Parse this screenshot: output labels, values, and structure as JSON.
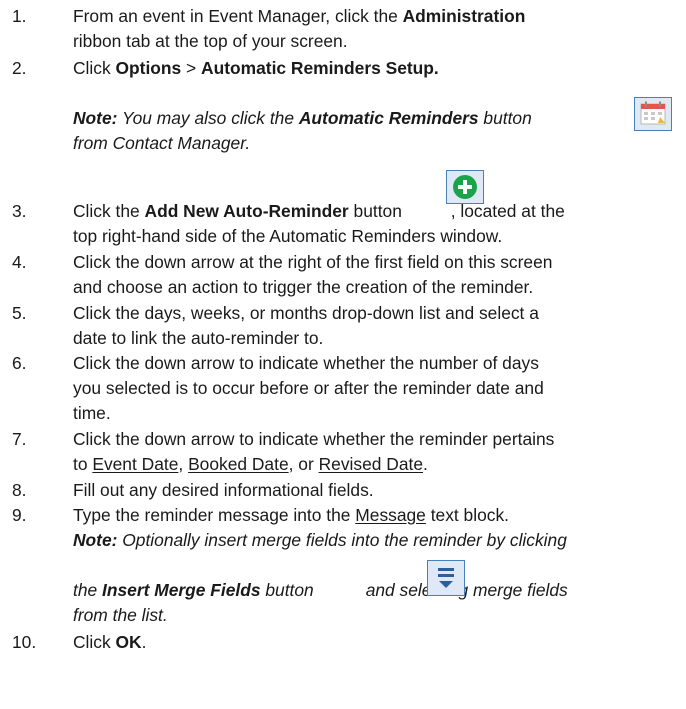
{
  "steps": [
    {
      "num": "1.",
      "line1": {
        "pre": "From an event in Event Manager, click the ",
        "bold": "Administration"
      },
      "line2": "ribbon tab at the top of your screen."
    },
    {
      "num": "2.",
      "pre": "Click ",
      "bold1": "Options",
      "mid": " > ",
      "bold2": "Automatic Reminders Setup."
    },
    {
      "note_label": "Note:",
      "pre": " You may also click the ",
      "bold": "Automatic Reminders",
      "post": " button",
      "line2": "from Contact Manager.",
      "icon": "calendar-reminder-icon"
    },
    {
      "num": "3.",
      "pre": "Click the ",
      "bold": "Add New Auto-Reminder",
      "post1": " button ",
      "post2": ", located at the",
      "line2": "top right-hand side of the Automatic Reminders window.",
      "icon": "add-plus-icon"
    },
    {
      "num": "4.",
      "line1": "Click the down arrow at the right of the first field on this screen",
      "line2": "and choose an action to trigger the creation of the reminder."
    },
    {
      "num": "5.",
      "line1": "Click the days, weeks, or months drop-down list and select a",
      "line2": "date to link the auto-reminder to."
    },
    {
      "num": "6.",
      "line1": "Click the down arrow to indicate whether the number of days",
      "line2": "you selected is to occur before or after the reminder date and",
      "line3": "time."
    },
    {
      "num": "7.",
      "line1": "Click the down arrow to indicate whether the reminder pertains",
      "pre": "to ",
      "u1": "Event Date",
      "sep1": ", ",
      "u2": "Booked Date",
      "sep2": ", or ",
      "u3": "Revised Date",
      "end": "."
    },
    {
      "num": "8.",
      "line1": "Fill out any desired informational fields."
    },
    {
      "num": "9.",
      "pre": "Type the reminder message into the ",
      "u": "Message",
      "post": " text block.",
      "note_label": "Note:",
      "note_text": " Optionally insert merge fields into the reminder by clicking",
      "note2_pre": "the ",
      "note2_bold": "Insert Merge Fields",
      "note2_post": " button",
      "note2_post2": "and selecting merge fields",
      "note3": "from the list.",
      "icon": "insert-merge-fields-icon"
    },
    {
      "num": "10.",
      "pre": "Click ",
      "bold": "OK",
      "post": "."
    }
  ],
  "colors": {
    "text": "#1a1a1a",
    "plus_green": "#1aa34a",
    "icon_frame": "#4a7fb8",
    "calendar_red": "#e2574c"
  }
}
